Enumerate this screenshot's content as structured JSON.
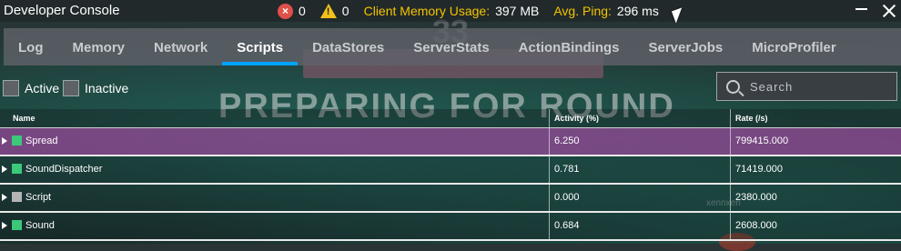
{
  "titlebar": {
    "title": "Developer Console",
    "error_count": "0",
    "warning_count": "0",
    "memory_label": "Client Memory Usage:",
    "memory_value": "397 MB",
    "ping_label": "Avg. Ping:",
    "ping_value": "296 ms"
  },
  "tabs": [
    {
      "label": "Log"
    },
    {
      "label": "Memory"
    },
    {
      "label": "Network"
    },
    {
      "label": "Scripts"
    },
    {
      "label": "DataStores"
    },
    {
      "label": "ServerStats"
    },
    {
      "label": "ActionBindings"
    },
    {
      "label": "ServerJobs"
    },
    {
      "label": "MicroProfiler"
    }
  ],
  "active_tab": "Scripts",
  "filters": {
    "active_label": "Active",
    "inactive_label": "Inactive"
  },
  "search": {
    "placeholder": "Search"
  },
  "table": {
    "headers": {
      "name": "Name",
      "activity": "Activity (%)",
      "rate": "Rate (/s)"
    },
    "rows": [
      {
        "name": "Spread",
        "activity": "6.250",
        "rate": "799415.000",
        "status_color": "#3cc87a",
        "highlight": true
      },
      {
        "name": "SoundDispatcher",
        "activity": "0.781",
        "rate": "71419.000",
        "status_color": "#3cc87a",
        "highlight": false
      },
      {
        "name": "Script",
        "activity": "0.000",
        "rate": "2380.000",
        "status_color": "#b4b4b4",
        "highlight": false
      },
      {
        "name": "Sound",
        "activity": "0.684",
        "rate": "2608.000",
        "status_color": "#3cc87a",
        "highlight": false
      }
    ]
  },
  "background": {
    "banner_text": "PREPARING FOR ROUND",
    "number_text": "33",
    "watermark": "xennxen"
  },
  "colors": {
    "accent": "#00a2ff",
    "stat_label": "#f5c400",
    "highlight_row": "#964696"
  }
}
